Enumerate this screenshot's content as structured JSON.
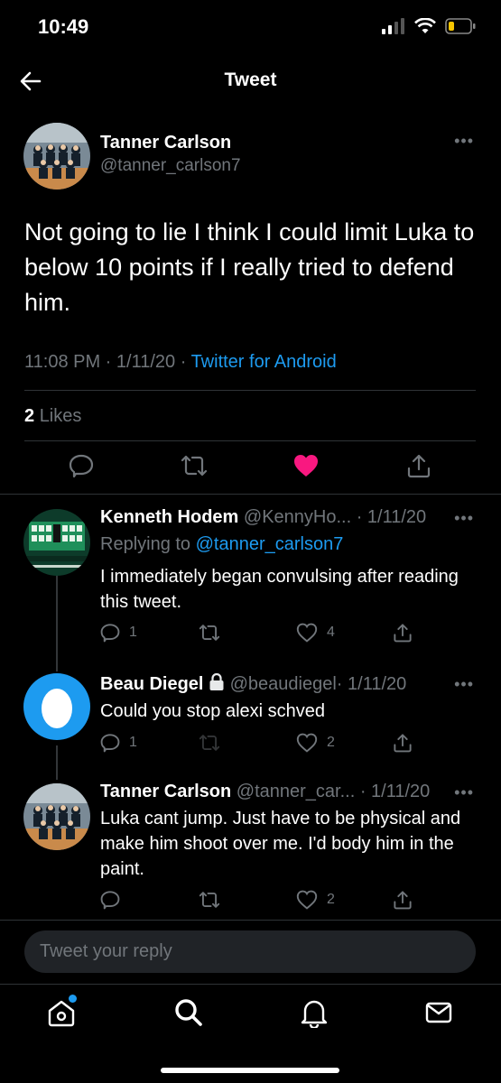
{
  "status": {
    "time": "10:49"
  },
  "header": {
    "title": "Tweet"
  },
  "main_tweet": {
    "author_name": "Tanner Carlson",
    "author_handle": "@tanner_carlson7",
    "text": "Not going to lie I think I could limit Luka to below 10 points if I really tried to defend him.",
    "time": "11:08 PM · 1/11/20 · ",
    "source": "Twitter for Android",
    "likes_count": "2",
    "likes_label": "Likes"
  },
  "replies": [
    {
      "name": "Kenneth Hodem",
      "handle": "@KennyHo...",
      "date": "· 1/11/20",
      "replying_prefix": "Replying to ",
      "replying_to": "@tanner_carlson7",
      "text": "I immediately began convulsing after reading this tweet.",
      "reply_count": "1",
      "like_count": "4"
    },
    {
      "name": "Beau Diegel",
      "handle": "@beaudiegel",
      "date": "· 1/11/20",
      "text": "Could you stop alexi schved",
      "reply_count": "1",
      "like_count": "2"
    },
    {
      "name": "Tanner Carlson",
      "handle": "@tanner_car...",
      "date": "· 1/11/20",
      "text": "Luka cant jump. Just have to be physical and make him shoot over me. I'd body him in the paint.",
      "like_count": "2"
    }
  ],
  "compose": {
    "placeholder": "Tweet your reply"
  },
  "icons": {
    "back": "arrow-left-icon",
    "reply": "speech-bubble-icon",
    "retweet": "retweet-icon",
    "like": "heart-icon",
    "share": "share-icon",
    "more": "more-dots-icon",
    "lock": "lock-icon",
    "home": "home-icon",
    "search": "search-icon",
    "notifications": "bell-icon",
    "messages": "envelope-icon"
  },
  "colors": {
    "accent": "#1d9bf0",
    "like_active": "#f91880",
    "muted": "#71767b"
  }
}
